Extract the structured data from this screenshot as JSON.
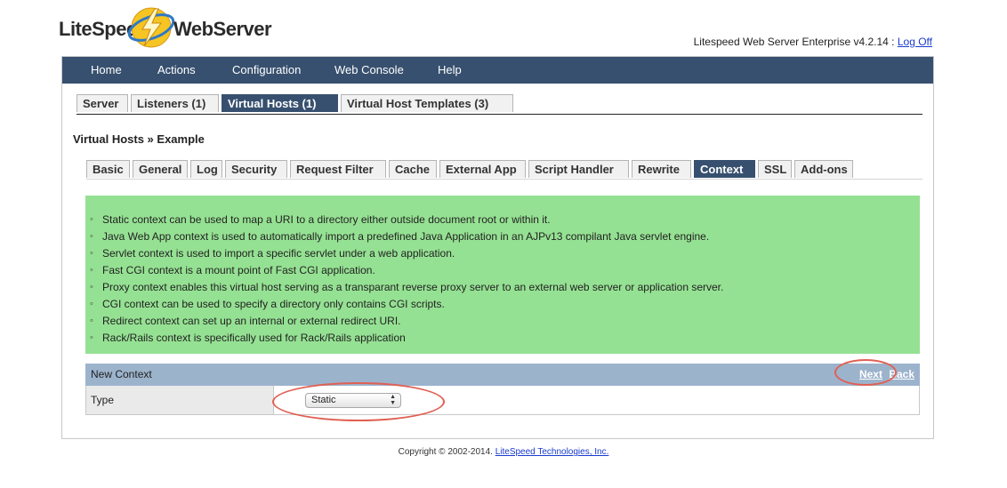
{
  "brand": {
    "left": "LiteSpeed",
    "right": "WebServer"
  },
  "status": {
    "text": "Litespeed Web Server Enterprise v4.2.14 :",
    "logoff": "Log Off"
  },
  "nav": {
    "items": [
      {
        "label": "Home"
      },
      {
        "label": "Actions"
      },
      {
        "label": "Configuration"
      },
      {
        "label": "Web Console"
      },
      {
        "label": "Help"
      }
    ]
  },
  "top_tabs": [
    {
      "label": "Server",
      "active": false
    },
    {
      "label": "Listeners (1)",
      "active": false
    },
    {
      "label": "Virtual Hosts (1)",
      "active": true
    },
    {
      "label": "Virtual Host Templates (3)",
      "active": false
    }
  ],
  "breadcrumb": "Virtual Hosts » Example",
  "sub_tabs": [
    {
      "label": "Basic",
      "active": false
    },
    {
      "label": "General",
      "active": false
    },
    {
      "label": "Log",
      "active": false
    },
    {
      "label": "Security",
      "active": false
    },
    {
      "label": "Request Filter",
      "active": false
    },
    {
      "label": "Cache",
      "active": false
    },
    {
      "label": "External App",
      "active": false
    },
    {
      "label": "Script Handler",
      "active": false
    },
    {
      "label": "Rewrite",
      "active": false
    },
    {
      "label": "Context",
      "active": true
    },
    {
      "label": "SSL",
      "active": false
    },
    {
      "label": "Add-ons",
      "active": false
    }
  ],
  "info": {
    "items": [
      "Static context can be used to map a URI to a directory either outside document root or within it.",
      "Java Web App context is used to automatically import a predefined Java Application in an AJPv13 compilant Java servlet engine.",
      "Servlet context is used to import a specific servlet under a web application.",
      "Fast CGI context is a mount point of Fast CGI application.",
      "Proxy context enables this virtual host serving as a transparant reverse proxy server to an external web server or application server.",
      "CGI context can be used to specify a directory only contains CGI scripts.",
      "Redirect context can set up an internal or external redirect URI.",
      "Rack/Rails context is specifically used for Rack/Rails application"
    ]
  },
  "context": {
    "title": "New Context",
    "next": "Next",
    "back": "Back",
    "type_label": "Type",
    "type_value": "Static"
  },
  "colors": {
    "nav_bg": "#37506f",
    "info_bg": "#95e193",
    "ctx_header_bg": "#9cb3cc",
    "annotation": "#e06054"
  },
  "footer": {
    "text": "Copyright © 2002-2014.",
    "link": "LiteSpeed Technologies, Inc."
  }
}
